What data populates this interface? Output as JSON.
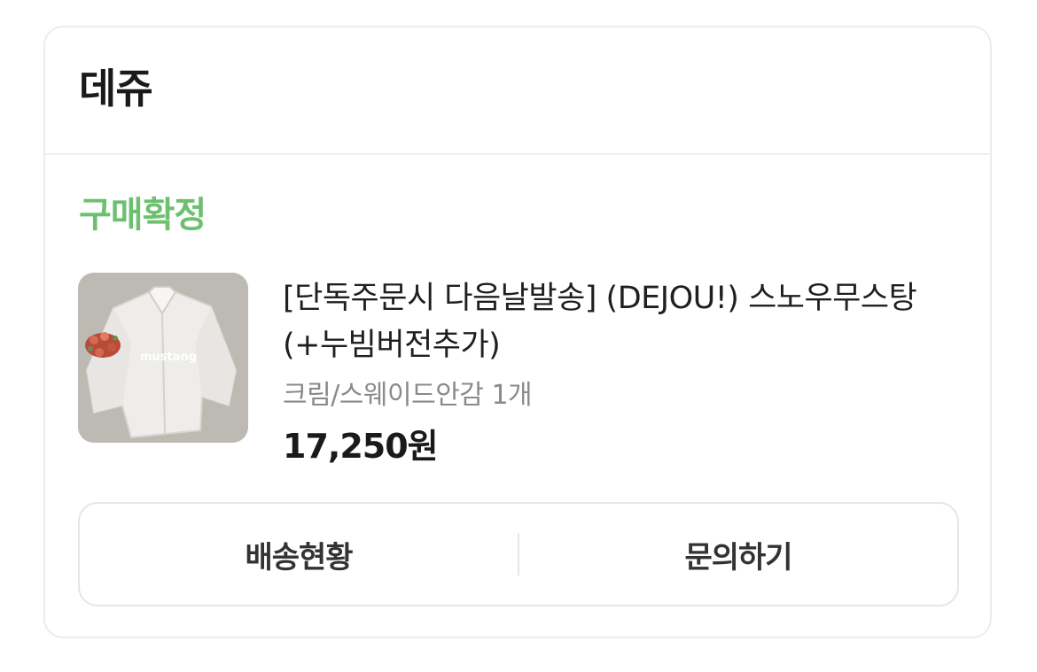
{
  "seller": {
    "name": "데쥬"
  },
  "order": {
    "status": "구매확정",
    "status_color": "#6cc070",
    "product": {
      "image_label": "mustang",
      "title": "[단독주문시 다음날발송] (DEJOU!) 스노우무스탕 (+누빔버전추가)",
      "option": "크림/스웨이드안감 1개",
      "price": "17,250원"
    }
  },
  "actions": {
    "shipping_label": "배송현황",
    "inquiry_label": "문의하기"
  }
}
